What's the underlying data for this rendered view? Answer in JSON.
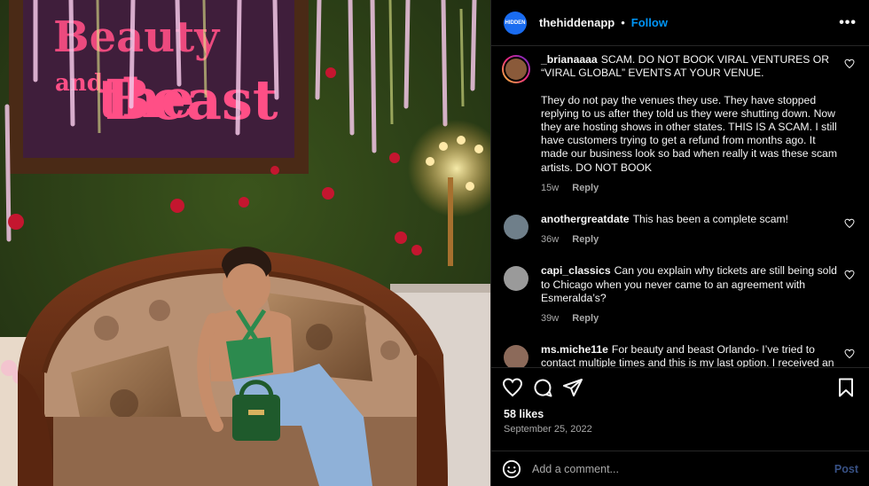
{
  "post": {
    "username": "thehiddenapp",
    "follow_label": "Follow",
    "app_avatar_text": "HIDDEN",
    "photo_sign_text": "Beauty and the Beast"
  },
  "comments": [
    {
      "username": "_brianaaaa",
      "text": "SCAM. DO NOT BOOK VIRAL VENTURES OR “VIRAL GLOBAL” EVENTS AT YOUR VENUE.\n\nThey do not pay the venues they use. They have stopped replying to us after they told us they were shutting down. Now they are hosting shows in other states. THIS IS A SCAM. I still have customers trying to get a refund from months ago. It made our business look so bad when really it was these scam artists. DO NOT BOOK",
      "age": "15w",
      "reply_label": "Reply"
    },
    {
      "username": "anothergreatdate",
      "text": "This has been a complete scam!",
      "age": "36w",
      "reply_label": "Reply"
    },
    {
      "username": "capi_classics",
      "text": "Can you explain why tickets are still being sold to Chicago when you never came to an agreement with Esmeralda’s?",
      "age": "39w",
      "reply_label": "Reply"
    },
    {
      "username": "ms.miche11e",
      "text": "For beauty and beast Orlando- I’ve tried to contact multiple times and this is my last option. I received an email stating that the date has been canceled and that I",
      "age": "",
      "reply_label": ""
    }
  ],
  "footer": {
    "likes": "58 likes",
    "date": "September 25, 2022",
    "comment_placeholder": "Add a comment...",
    "post_label": "Post"
  },
  "colors": {
    "accent": "#0095f6",
    "muted": "#a8a8a8",
    "background": "#000000"
  }
}
